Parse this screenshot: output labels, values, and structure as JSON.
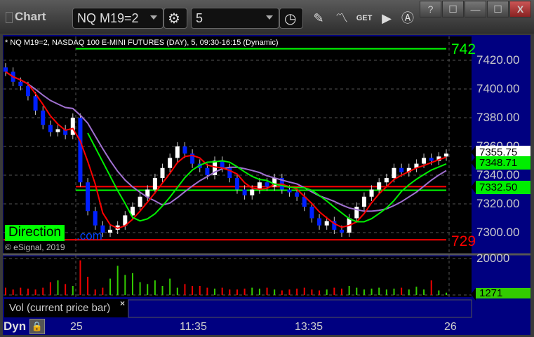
{
  "window": {
    "title": "Chart",
    "symbol": "NQ M19=2",
    "interval": "5",
    "help": "?",
    "minimize": "—",
    "maximize": "☐",
    "close": "X"
  },
  "toolbar": {
    "icons": [
      "settings-icon",
      "clock-icon",
      "pencil-icon",
      "study-icon",
      "get-icon",
      "play-icon",
      "text-icon"
    ],
    "get_label": "GET"
  },
  "chart": {
    "header": "* NQ M19=2, NASDAQ 100 E-MINI FUTURES (DAY), 5, 09:30-16:15 (Dynamic)",
    "direction_label": "Direction",
    "direction_suffix": ".com",
    "copyright": "© eSignal, 2019",
    "top_line_label": "742",
    "bottom_line_label": "729"
  },
  "chart_data": {
    "type": "candlestick",
    "ylim": [
      7290,
      7430
    ],
    "yticks": [
      "7420.00",
      "7400.00",
      "7380.00",
      "7360.00",
      "7340.00",
      "7320.00",
      "7300.00"
    ],
    "closes": [
      7412,
      7405,
      7402,
      7395,
      7385,
      7375,
      7370,
      7372,
      7368,
      7380,
      7335,
      7315,
      7305,
      7300,
      7302,
      7305,
      7312,
      7318,
      7325,
      7330,
      7338,
      7345,
      7352,
      7360,
      7355,
      7348,
      7345,
      7340,
      7350,
      7345,
      7338,
      7330,
      7326,
      7330,
      7335,
      7332,
      7338,
      7330,
      7328,
      7325,
      7318,
      7310,
      7305,
      7308,
      7302,
      7300,
      7310,
      7318,
      7325,
      7330,
      7335,
      7338,
      7345,
      7342,
      7345,
      7348,
      7352,
      7350,
      7353,
      7355
    ],
    "volume": [
      4000,
      3000,
      4000,
      3500,
      3000,
      4000,
      7000,
      8000,
      6000,
      5000,
      19000,
      10000,
      3000,
      4000,
      9000,
      16000,
      11000,
      12000,
      7000,
      6000,
      8000,
      5000,
      9000,
      4000,
      6000,
      5000,
      5000,
      4000,
      3500,
      4000,
      3000,
      3000,
      3500,
      4000,
      3500,
      4000,
      3000,
      2500,
      3000,
      3500,
      4000,
      3000,
      2500,
      3000,
      4000,
      3500,
      5000,
      4000,
      3000,
      3500,
      4000,
      3000,
      3500,
      4000,
      3000,
      4500,
      3000,
      8000,
      2500,
      1271
    ],
    "price_tags": [
      {
        "value": "7355.75",
        "color": "#ffffff"
      },
      {
        "value": "7348.71",
        "color": "#00ee00"
      },
      {
        "value": "7332.50",
        "color": "#00ee00"
      }
    ],
    "volume_axis": "20000",
    "volume_tag": "1271",
    "levels": {
      "top": 7428,
      "bottom": 7295,
      "green": 7331,
      "red": 7332
    },
    "xticks": [
      "25",
      "11:35",
      "13:35",
      "26"
    ]
  },
  "volume_pane": {
    "label": "Vol (current price bar)",
    "close": "×"
  },
  "footer": {
    "mode": "Dyn",
    "lock": "🔒"
  }
}
